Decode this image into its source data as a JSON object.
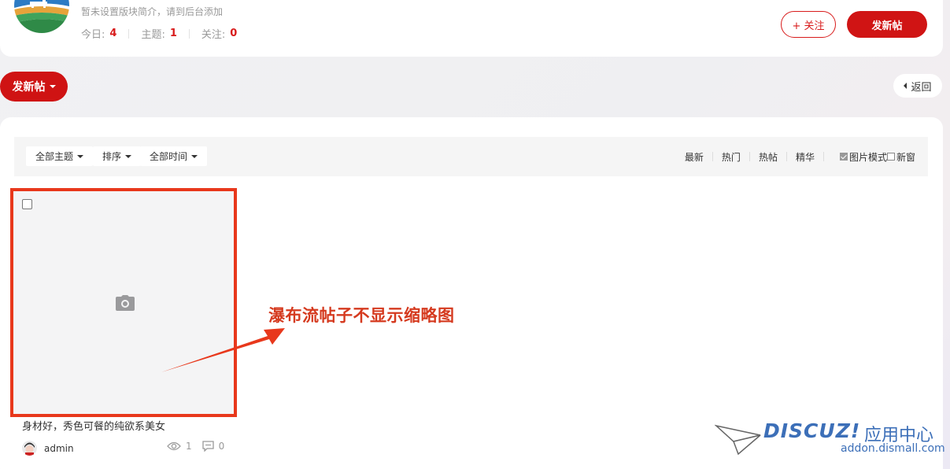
{
  "header": {
    "description": "暂未设置版块简介，请到后台添加",
    "stats": [
      {
        "label": "今日:",
        "value": "4"
      },
      {
        "label": "主题:",
        "value": "1"
      },
      {
        "label": "关注:",
        "value": "0"
      }
    ],
    "follow_label": "+ 关注",
    "newpost_label": "发新帖"
  },
  "actions": {
    "newpost_label": "发新帖",
    "back_label": "返回"
  },
  "filters": {
    "dropdowns": [
      "全部主题",
      "排序",
      "全部时间"
    ],
    "sort_links": [
      "最新",
      "热门",
      "热帖",
      "精华"
    ],
    "image_mode_label": "图片模式",
    "image_mode_checked": true,
    "new_window_label": "新窗",
    "new_window_checked": false
  },
  "threads": [
    {
      "title": "身材好，秀色可餐的纯欲系美女",
      "author": "admin",
      "views": "1",
      "replies": "0"
    }
  ],
  "annotation": {
    "text": "瀑布流帖子不显示缩略图",
    "color": "#e8381c"
  },
  "watermark": {
    "brand": "DISCUZ!",
    "center": "应用中心",
    "url": "addon.dismall.com"
  },
  "colors": {
    "accent": "#d01414",
    "stat_value": "#d81b1b"
  }
}
